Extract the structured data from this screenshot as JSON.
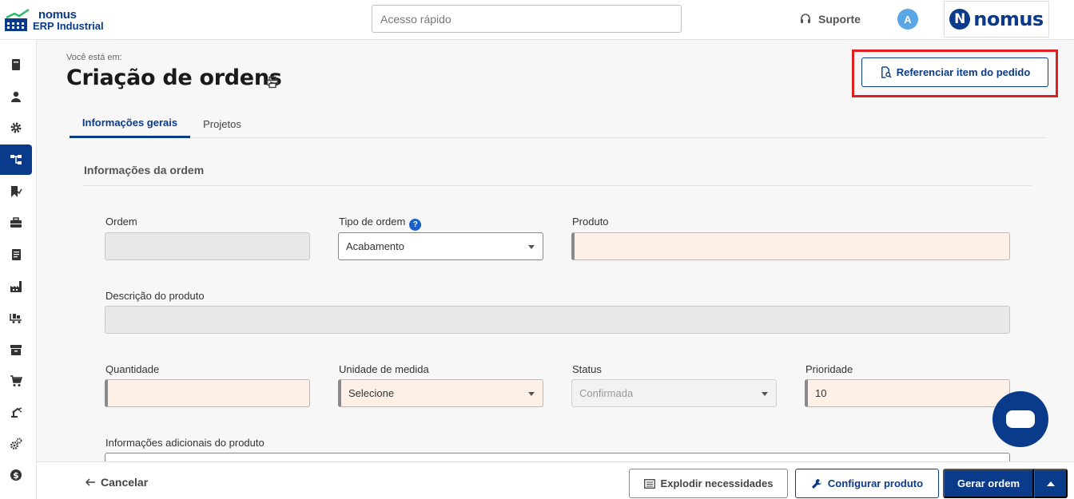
{
  "header": {
    "logo_line1": "nomus",
    "logo_line2": "ERP Industrial",
    "quick_access_placeholder": "Acesso rápido",
    "support_label": "Suporte",
    "avatar_initial": "A",
    "brand_text": "nomus",
    "brand_letter": "N"
  },
  "sidebar": {
    "items": [
      {
        "icon": "book-icon"
      },
      {
        "icon": "person-icon"
      },
      {
        "icon": "gear-icon"
      },
      {
        "icon": "hierarchy-icon",
        "active": true
      },
      {
        "icon": "bookmark-check-icon"
      },
      {
        "icon": "briefcase-icon"
      },
      {
        "icon": "notebook-icon"
      },
      {
        "icon": "factory-icon"
      },
      {
        "icon": "conveyor-icon"
      },
      {
        "icon": "archive-icon"
      },
      {
        "icon": "cart-icon"
      },
      {
        "icon": "robot-arm-icon"
      },
      {
        "icon": "gears-icon"
      },
      {
        "icon": "dollar-icon"
      }
    ]
  },
  "page": {
    "breadcrumb": "Você está em:",
    "title": "Criação de ordens",
    "reference_button": "Referenciar item do pedido"
  },
  "tabs": [
    {
      "label": "Informações gerais",
      "active": true
    },
    {
      "label": "Projetos",
      "active": false
    }
  ],
  "section": {
    "title": "Informações da ordem"
  },
  "form": {
    "ordem_label": "Ordem",
    "ordem_value": "",
    "tipo_label": "Tipo de ordem",
    "tipo_help": "?",
    "tipo_value": "Acabamento",
    "produto_label": "Produto",
    "produto_value": "",
    "descricao_label": "Descrição do produto",
    "descricao_value": "",
    "quantidade_label": "Quantidade",
    "quantidade_value": "",
    "unidade_label": "Unidade de medida",
    "unidade_value": "Selecione",
    "status_label": "Status",
    "status_value": "Confirmada",
    "prioridade_label": "Prioridade",
    "prioridade_value": "10",
    "info_adicionais_label": "Informações adicionais do produto"
  },
  "footer": {
    "cancel_label": "Cancelar",
    "explode_label": "Explodir necessidades",
    "config_label": "Configurar produto",
    "gerar_label": "Gerar ordem"
  },
  "colors": {
    "primary": "#0a3a8a",
    "highlight": "#e02020",
    "required_bg": "#fdf1e7"
  }
}
